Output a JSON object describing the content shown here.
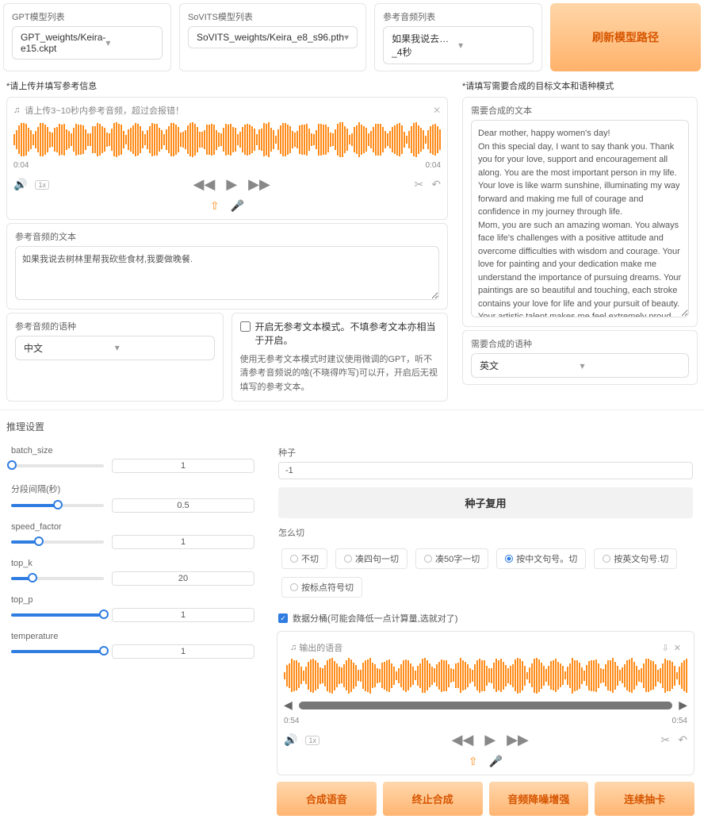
{
  "top": {
    "gpt_label": "GPT模型列表",
    "gpt_value": "GPT_weights/Keira-e15.ckpt",
    "sovits_label": "SoVITS模型列表",
    "sovits_value": "SoVITS_weights/Keira_e8_s96.pth",
    "ref_label": "参考音频列表",
    "ref_value": "如果我说去…_4秒",
    "refresh": "刷新模型路径"
  },
  "left": {
    "note": "*请上传并填写参考信息",
    "upload_hint": "请上传3~10秒内参考音频，超过会报错！",
    "t0": "0:04",
    "t1": "0:04",
    "rate": "1x",
    "ref_text_label": "参考音频的文本",
    "ref_text_value": "如果我说去树林里帮我砍些食材,我要做晚餐.",
    "ref_lang_label": "参考音频的语种",
    "ref_lang_value": "中文",
    "no_ref_cb": "开启无参考文本模式。不填参考文本亦相当于开启。",
    "no_ref_desc": "使用无参考文本模式时建议使用微调的GPT，听不清参考音频说的啥(不晓得咋写)可以开，开启后无视填写的参考文本。"
  },
  "right": {
    "note": "*请填写需要合成的目标文本和语种模式",
    "text_label": "需要合成的文本",
    "text_value": "Dear mother, happy women's day!\nOn this special day, I want to say thank you. Thank you for your love, support and encouragement all along. You are the most important person in my life. Your love is like warm sunshine, illuminating my way forward and making me full of courage and confidence in my journey through life.\nMom, you are such an amazing woman. You always face life's challenges with a positive attitude and overcome difficulties with wisdom and courage. Your love for painting and your dedication make me understand the importance of pursuing dreams. Your paintings are so beautiful and touching, each stroke contains your love for life and your pursuit of beauty. Your artistic talent makes me feel extremely proud.\nOn this special day, I wish your life was as colorful as your paintings, and your heart would always be filled with artistic inspiration. May you be happy and happy every day, and may all your dreams come true.\nMom, I love you! Again, happy women's day!",
    "lang_label": "需要合成的语种",
    "lang_value": "英文"
  },
  "infer": {
    "title": "推理设置",
    "batch_size": {
      "label": "batch_size",
      "value": "1",
      "pct": 1
    },
    "split": {
      "label": "分段间隔(秒)",
      "value": "0.5",
      "pct": 50
    },
    "speed": {
      "label": "speed_factor",
      "value": "1",
      "pct": 30
    },
    "top_k": {
      "label": "top_k",
      "value": "20",
      "pct": 23
    },
    "top_p": {
      "label": "top_p",
      "value": "1",
      "pct": 100
    },
    "temperature": {
      "label": "temperature",
      "value": "1",
      "pct": 100
    }
  },
  "seed": {
    "label": "种子",
    "value": "-1",
    "reuse": "种子复用",
    "cut_label": "怎么切",
    "cuts": [
      "不切",
      "凑四句一切",
      "凑50字一切",
      "按中文句号。切",
      "按英文句号.切",
      "按标点符号切"
    ],
    "cut_sel": 3,
    "bucket": "数据分桶(可能会降低一点计算量,选就对了)"
  },
  "output": {
    "label": "输出的语音",
    "t0": "0:54",
    "t1": "0:54",
    "rate": "1x"
  },
  "actions": [
    "合成语音",
    "终止合成",
    "音频降噪增强",
    "连续抽卡"
  ]
}
